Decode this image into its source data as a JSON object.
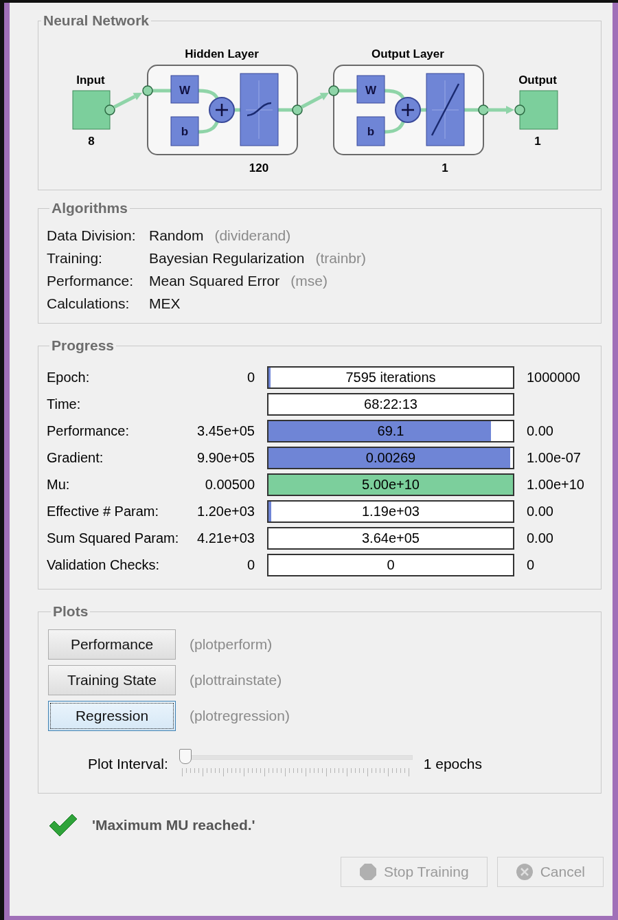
{
  "network": {
    "title": "Neural Network",
    "input": {
      "label": "Input",
      "size": "8"
    },
    "layers": [
      {
        "title": "Hidden Layer",
        "size": "120",
        "weight_label": "W",
        "bias_label": "b",
        "kind": "sigmoid"
      },
      {
        "title": "Output Layer",
        "size": "1",
        "weight_label": "W",
        "bias_label": "b",
        "kind": "linear"
      }
    ],
    "output": {
      "label": "Output",
      "size": "1"
    }
  },
  "algorithms": {
    "title": "Algorithms",
    "rows": [
      {
        "label": "Data Division:",
        "value": "Random",
        "function": "(dividerand)"
      },
      {
        "label": "Training:",
        "value": "Bayesian Regularization",
        "function": "(trainbr)"
      },
      {
        "label": "Performance:",
        "value": "Mean Squared Error",
        "function": "(mse)"
      },
      {
        "label": "Calculations:",
        "value": "MEX"
      }
    ]
  },
  "progress": {
    "title": "Progress",
    "rows": [
      {
        "label": "Epoch:",
        "start": "0",
        "bar_text": "7595 iterations",
        "level": 0.008,
        "end": "1000000"
      },
      {
        "label": "Time:",
        "bar_text": "68:22:13"
      },
      {
        "label": "Performance:",
        "start": "3.45e+05",
        "bar_text": "69.1",
        "level": 0.91,
        "color": "#6f85d6",
        "end": "0.00"
      },
      {
        "label": "Gradient:",
        "start": "9.90e+05",
        "bar_text": "0.00269",
        "level": 0.99,
        "color": "#6f85d6",
        "end": "1.00e-07"
      },
      {
        "label": "Mu:",
        "start": "0.00500",
        "bar_text": "5.00e+10",
        "level": 1,
        "color": "#7ccf9c",
        "end": "1.00e+10"
      },
      {
        "label": "Effective # Param:",
        "start": "1.20e+03",
        "bar_text": "1.19e+03",
        "level": 0.01,
        "end": "0.00"
      },
      {
        "label": "Sum Squared Param:",
        "start": "4.21e+03",
        "bar_text": "3.64e+05",
        "end": "0.00"
      },
      {
        "label": "Validation Checks:",
        "start": "0",
        "bar_text": "0",
        "end": "0"
      }
    ]
  },
  "plots": {
    "title": "Plots",
    "buttons": [
      {
        "label": "Performance",
        "function": "(plotperform)",
        "focused": false
      },
      {
        "label": "Training State",
        "function": "(plottrainstate)",
        "focused": false
      },
      {
        "label": "Regression",
        "function": "(plotregression)",
        "focused": true
      }
    ],
    "interval": {
      "label": "Plot Interval:",
      "level": 0,
      "reading": "1 epochs"
    }
  },
  "status": {
    "message": "'Maximum MU reached.'"
  },
  "buttons": [
    {
      "kind": "stop",
      "label": "Stop Training",
      "disabled": true
    },
    {
      "kind": "cancel",
      "label": "Cancel",
      "disabled": true
    }
  ]
}
